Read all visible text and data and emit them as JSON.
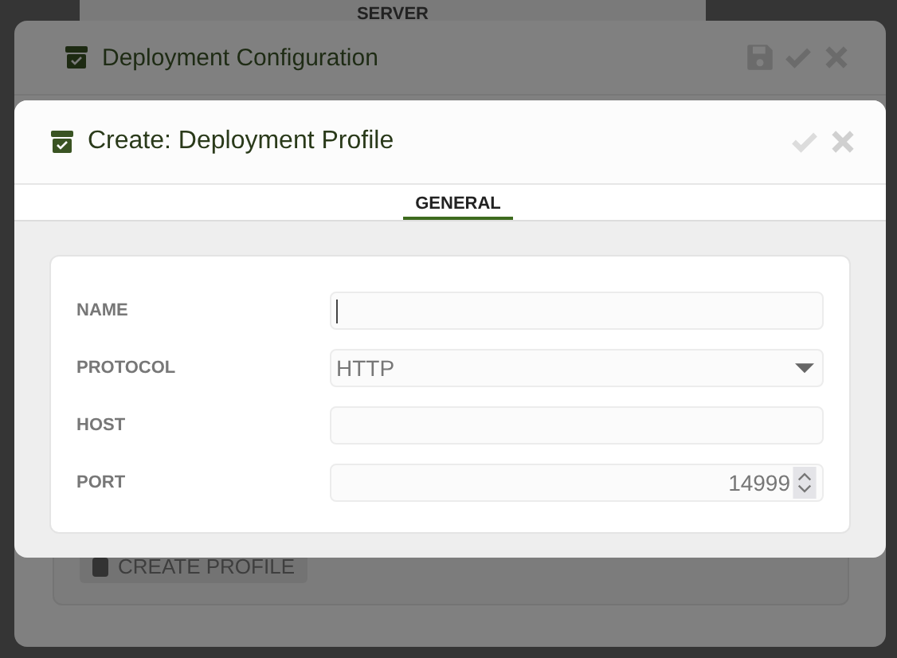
{
  "background": {
    "heading": "SERVER",
    "button": "CREATE PROFILE"
  },
  "parent_dialog": {
    "title": "Deployment Configuration"
  },
  "dialog": {
    "title": "Create: Deployment Profile",
    "tabs": [
      {
        "label": "GENERAL",
        "selected": true
      }
    ],
    "fields": [
      {
        "label": "NAME",
        "kind": "text",
        "focused": true
      },
      {
        "label": "PROTOCOL",
        "kind": "select",
        "value": "HTTP",
        "focused": false
      },
      {
        "label": "HOST",
        "kind": "text",
        "focused": false
      },
      {
        "label": "PORT",
        "kind": "number",
        "value": "14999",
        "focused": false
      }
    ]
  }
}
